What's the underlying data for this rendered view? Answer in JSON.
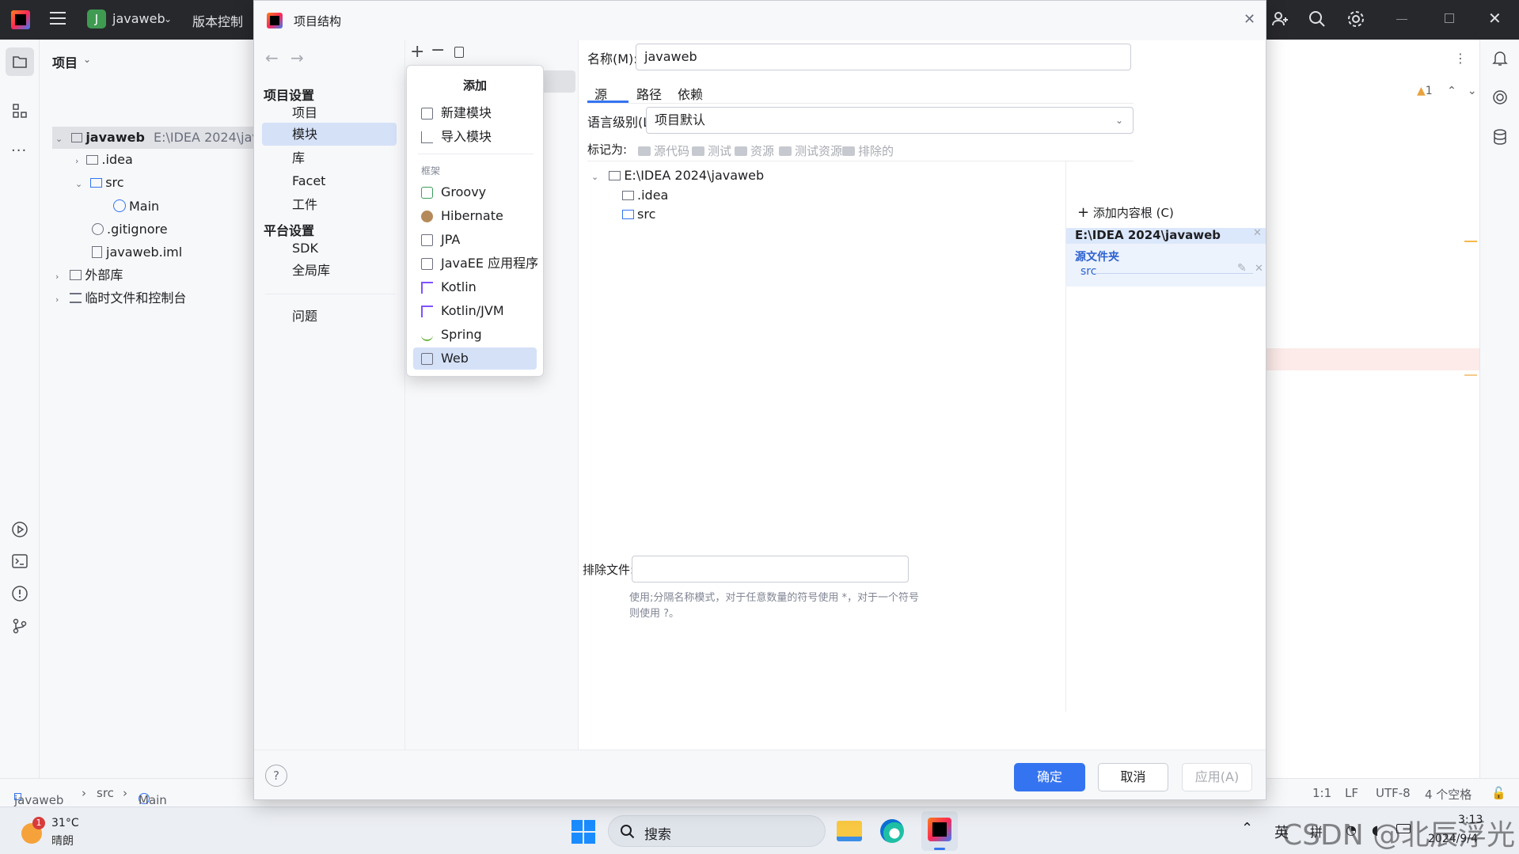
{
  "ide": {
    "project_name": "javaweb",
    "project_initial": "J",
    "vcs_menu": "版本控制",
    "panel_title": "项目",
    "tree": [
      {
        "label": "javaweb",
        "path": "E:\\IDEA 2024\\javaweb"
      },
      {
        "label": ".idea"
      },
      {
        "label": "src"
      },
      {
        "label": "Main"
      },
      {
        "label": ".gitignore"
      },
      {
        "label": "javaweb.iml"
      },
      {
        "label": "外部库"
      },
      {
        "label": "临时文件和控制台"
      }
    ],
    "warning_count": "1",
    "status": {
      "breadcrumb": [
        "javaweb",
        "src",
        "Main"
      ],
      "position": "1:1",
      "line_sep": "LF",
      "encoding": "UTF-8",
      "indent": "4 个空格"
    }
  },
  "dialog": {
    "title": "项目结构",
    "nav": {
      "section_project": "项目设置",
      "project_items": [
        "项目",
        "模块",
        "库",
        "Facet",
        "工件"
      ],
      "section_platform": "平台设置",
      "platform_items": [
        "SDK",
        "全局库"
      ],
      "problems": "问题"
    },
    "popup": {
      "title": "添加",
      "top_items": [
        "新建模块",
        "导入模块"
      ],
      "section": "框架",
      "frameworks": [
        "Groovy",
        "Hibernate",
        "JPA",
        "JavaEE 应用程序",
        "Kotlin",
        "Kotlin/JVM",
        "Spring",
        "Web"
      ]
    },
    "name_label": "名称(M):",
    "name_value": "javaweb",
    "tabs": [
      "源",
      "路径",
      "依赖"
    ],
    "lang_label": "语言级别(L):",
    "lang_value": "项目默认",
    "mark_label": "标记为:",
    "marks": [
      "源代码",
      "测试",
      "资源",
      "测试资源",
      "排除的"
    ],
    "source_tree": [
      ".idea",
      "src"
    ],
    "source_root": "E:\\IDEA 2024\\javaweb",
    "add_content_root": "添加内容根 (C)",
    "content_root": "E:\\IDEA 2024\\javaweb",
    "source_folders_label": "源文件夹",
    "source_folder": "src",
    "exclude_label": "排除文件:",
    "exclude_value": "",
    "hint_line1": "使用;分隔名称模式，对于任意数量的符号使用 *，对于一个符号",
    "hint_line2": "则使用 ?。",
    "ok": "确定",
    "cancel": "取消",
    "apply": "应用(A)"
  },
  "taskbar": {
    "temperature": "31°C",
    "weather": "晴朗",
    "weather_badge": "1",
    "search": "搜索",
    "ime": "英",
    "ime2": "拼",
    "time": "3:13",
    "date": "2024/9/4",
    "watermark": "CSDN @北辰浮光"
  },
  "colors": {
    "accent": "#3574f0",
    "selection": "#d5e1f7",
    "titlebar": "#27282c"
  }
}
